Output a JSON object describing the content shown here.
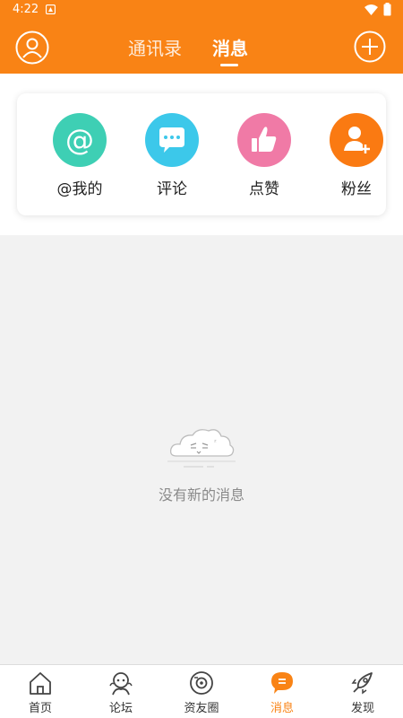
{
  "status_bar": {
    "time": "4:22"
  },
  "header": {
    "tabs": [
      {
        "label": "通讯录",
        "active": false
      },
      {
        "label": "消息",
        "active": true
      }
    ],
    "accent_color": "#f98315"
  },
  "quick_actions": [
    {
      "label": "@我的",
      "icon": "at-icon",
      "color": "#3ecfb4"
    },
    {
      "label": "评论",
      "icon": "comment-icon",
      "color": "#3cc8ea"
    },
    {
      "label": "点赞",
      "icon": "thumbs-up-icon",
      "color": "#f07aa6"
    },
    {
      "label": "粉丝",
      "icon": "add-user-icon",
      "color": "#fa7a12"
    }
  ],
  "empty_state": {
    "text": "没有新的消息"
  },
  "bottom_nav": {
    "items": [
      {
        "label": "首页",
        "icon": "home-icon",
        "active": false
      },
      {
        "label": "论坛",
        "icon": "forum-icon",
        "active": false
      },
      {
        "label": "资友圈",
        "icon": "camera-circle-icon",
        "active": false
      },
      {
        "label": "消息",
        "icon": "message-icon",
        "active": true
      },
      {
        "label": "发现",
        "icon": "rocket-icon",
        "active": false
      }
    ]
  }
}
